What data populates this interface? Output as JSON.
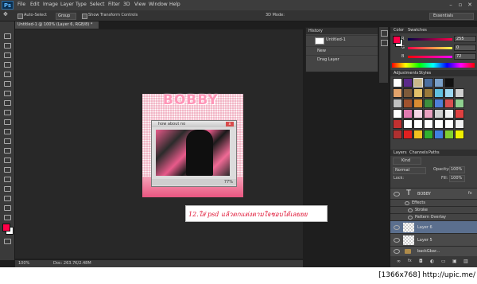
{
  "app": {
    "logo": "Ps"
  },
  "menu": [
    "File",
    "Edit",
    "Image",
    "Layer",
    "Type",
    "Select",
    "Filter",
    "3D",
    "View",
    "Window",
    "Help"
  ],
  "options_bar": {
    "auto_select_label": "Auto-Select",
    "auto_select_value": "Group",
    "transform_label": "Show Transform Controls",
    "mode_label": "3D Mode:",
    "workspace": "Essentials"
  },
  "document": {
    "tab_title": "Untitled-1 @ 100% (Layer 6, RGB/8) *",
    "zoom": "100%",
    "doc_size": "Doc: 263.7K/2.48M"
  },
  "artwork": {
    "heading": "BOBBY",
    "window_title": "how about no",
    "window_zoom": "77%",
    "caption": "12.ใส่ psd แล้วตกแต่งตามใจชอบได้เลยยย"
  },
  "history": {
    "title": "History",
    "items": [
      {
        "label": "Untitled-1"
      },
      {
        "label": "New"
      },
      {
        "label": "Drag Layer"
      }
    ]
  },
  "color_panel": {
    "tabs": [
      "Color",
      "Swatches"
    ],
    "channels": [
      {
        "label": "R",
        "value": "255"
      },
      {
        "label": "G",
        "value": "0"
      },
      {
        "label": "B",
        "value": "72"
      }
    ],
    "colors": {
      "foreground": "#ff0048",
      "background": "#ffffff"
    }
  },
  "styles_panel": {
    "tabs": [
      "Adjustments",
      "Styles"
    ]
  },
  "layers_panel": {
    "tabs": [
      "Layers",
      "Channels",
      "Paths"
    ],
    "kind_label": "Kind",
    "blend_mode": "Normal",
    "opacity_label": "Opacity:",
    "opacity_value": "100%",
    "lock_label": "Lock:",
    "fill_label": "Fill:",
    "fill_value": "100%",
    "layers": [
      {
        "name": "BOBBY",
        "type": "text"
      },
      {
        "name": "Effects",
        "type": "effects"
      },
      {
        "name": "Stroke",
        "type": "effect"
      },
      {
        "name": "Pattern Overlay",
        "type": "effect"
      },
      {
        "name": "Layer 6",
        "type": "raster",
        "selected": true
      },
      {
        "name": "Layer 5",
        "type": "raster"
      },
      {
        "name": "backGbar...",
        "type": "group"
      }
    ]
  },
  "watermark": "[1366x768] http://upic.me/"
}
